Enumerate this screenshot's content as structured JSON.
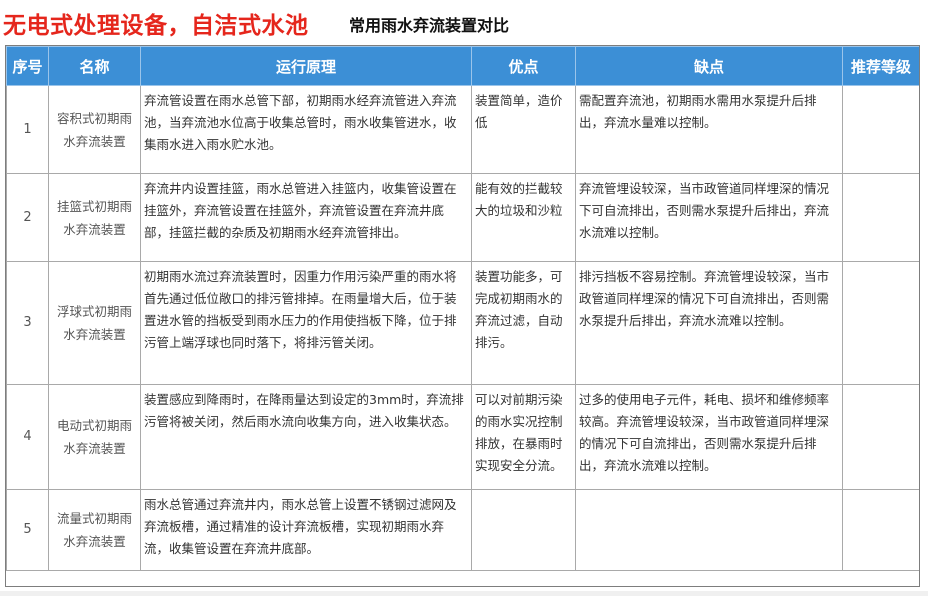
{
  "title": {
    "main": "无电式处理设备，自洁式水池",
    "sub": "常用雨水弃流装置对比"
  },
  "table": {
    "headers": [
      "序号",
      "名称",
      "运行原理",
      "优点",
      "缺点",
      "推荐等级"
    ],
    "rows": [
      {
        "no": "1",
        "name": "容积式初期雨水弃流装置",
        "principle": "弃流管设置在雨水总管下部，初期雨水经弃流管进入弃流池，当弃流池水位高于收集总管时，雨水收集管进水，收集雨水进入雨水贮水池。",
        "pros": "装置简单，造价低",
        "cons": "需配置弃流池，初期雨水需用水泵提升后排出，弃流水量难以控制。",
        "level": ""
      },
      {
        "no": "2",
        "name": "挂篮式初期雨水弃流装置",
        "principle": "弃流井内设置挂篮，雨水总管进入挂篮内，收集管设置在挂篮外，弃流管设置在挂篮外，弃流管设置在弃流井底部，挂篮拦截的杂质及初期雨水经弃流管排出。",
        "pros": "能有效的拦截较大的垃圾和沙粒",
        "cons": "弃流管埋设较深，当市政管道同样埋深的情况下可自流排出，否则需水泵提升后排出，弃流水流难以控制。",
        "level": ""
      },
      {
        "no": "3",
        "name": "浮球式初期雨水弃流装置",
        "principle": "初期雨水流过弃流装置时，因重力作用污染严重的雨水将首先通过低位敞口的排污管排掉。在雨量增大后，位于装置进水管的挡板受到雨水压力的作用使挡板下降，位于排污管上端浮球也同时落下，将排污管关闭。",
        "pros": "装置功能多，可完成初期雨水的弃流过滤，自动排污。",
        "cons": "排污挡板不容易控制。弃流管埋设较深，当市政管道同样埋深的情况下可自流排出，否则需水泵提升后排出，弃流水流难以控制。",
        "level": ""
      },
      {
        "no": "4",
        "name": "电动式初期雨水弃流装置",
        "principle": "装置感应到降雨时，在降雨量达到设定的3mm时，弃流排污管将被关闭，然后雨水流向收集方向，进入收集状态。",
        "pros": "可以对前期污染的雨水实况控制排放，在暴雨时实现安全分流。",
        "cons": "过多的使用电子元件，耗电、损坏和维修频率较高。弃流管埋设较深，当市政管道同样埋深的情况下可自流排出，否则需水泵提升后排出，弃流水流难以控制。",
        "level": ""
      },
      {
        "no": "5",
        "name": "流量式初期雨水弃流装置",
        "principle": "雨水总管通过弃流井内，雨水总管上设置不锈钢过滤网及弃流板槽，通过精准的设计弃流板槽，实现初期雨水弃流，收集管设置在弃流井底部。",
        "pros": "",
        "cons": "",
        "level": ""
      }
    ]
  }
}
